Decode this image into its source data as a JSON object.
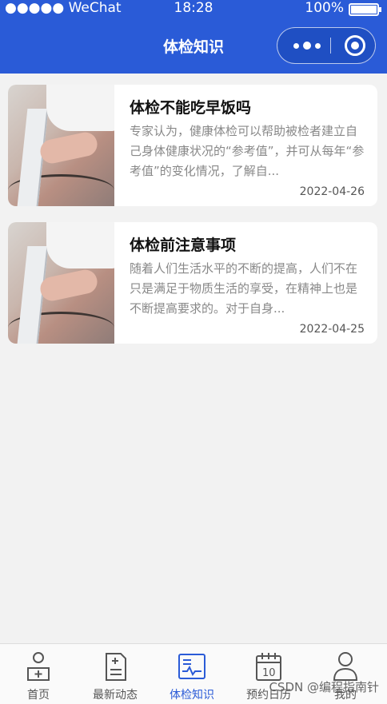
{
  "status_bar": {
    "carrier": "●●●●● WeChat",
    "time": "18:28",
    "battery_text": "100%",
    "battery_level": 1.0
  },
  "nav": {
    "title": "体检知识"
  },
  "articles": [
    {
      "title": "体检不能吃早饭吗",
      "summary": "专家认为，健康体检可以帮助被检者建立自己身体健康状况的“参考值”，并可从每年“参考值”的变化情况，了解自...",
      "date": "2022-04-26"
    },
    {
      "title": "体检前注意事项",
      "summary": "随着人们生活水平的不断的提高，人们不在只是满足于物质生活的享受，在精神上也是不断提高要求的。对于自身...",
      "date": "2022-04-25"
    }
  ],
  "tabs": [
    {
      "label": "首页",
      "icon": "home-icon",
      "active": false
    },
    {
      "label": "最新动态",
      "icon": "news-icon",
      "active": false
    },
    {
      "label": "体检知识",
      "icon": "knowledge-icon",
      "active": true
    },
    {
      "label": "预约日历",
      "icon": "calendar-icon",
      "active": false
    },
    {
      "label": "我的",
      "icon": "user-icon",
      "active": false
    }
  ],
  "watermark": "CSDN @编程指南针",
  "colors": {
    "primary": "#2a5bd7",
    "inactive_tab": "#555555"
  }
}
